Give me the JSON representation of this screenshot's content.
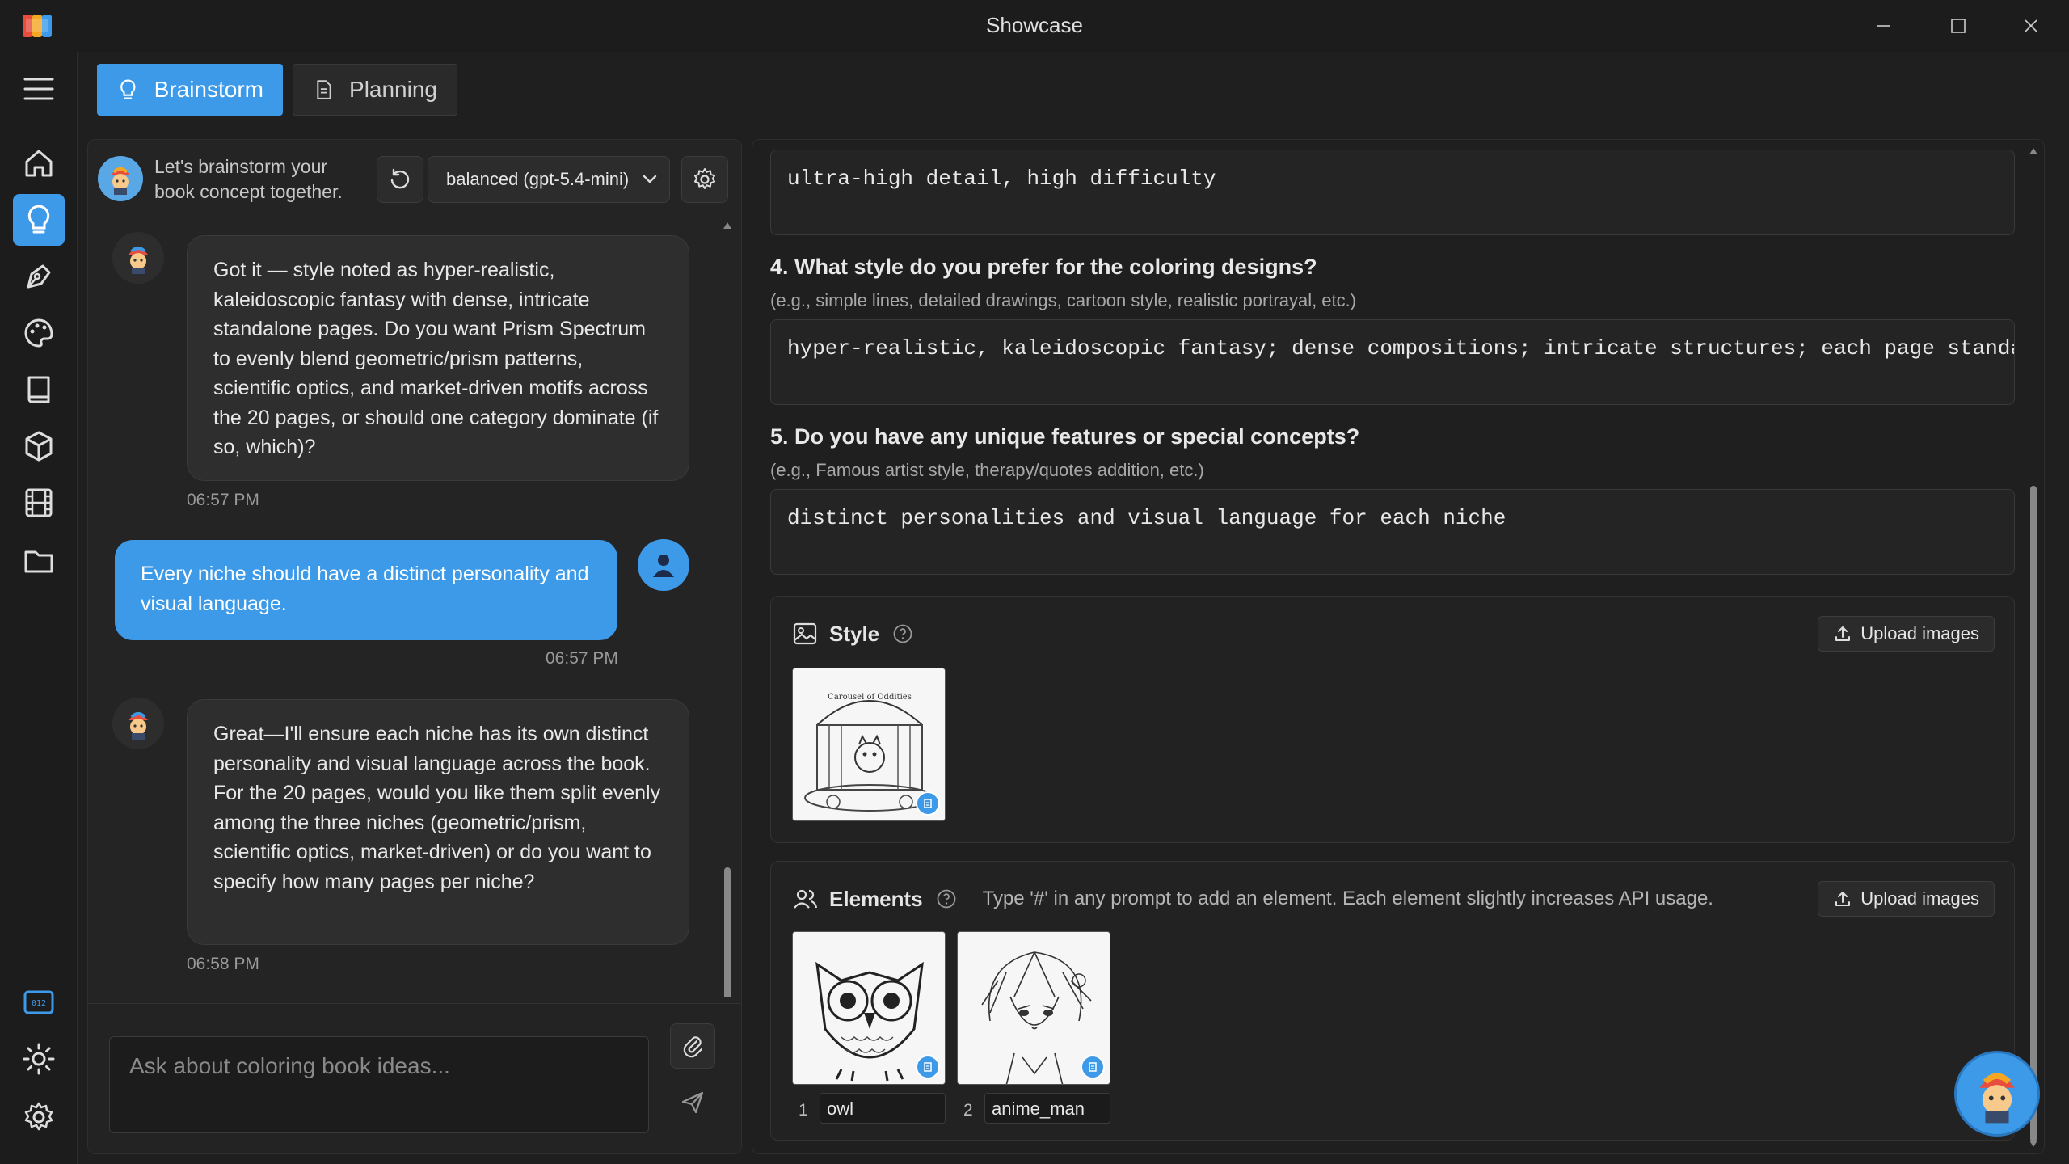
{
  "window": {
    "title": "Showcase"
  },
  "tabs": [
    {
      "label": "Brainstorm",
      "active": true
    },
    {
      "label": "Planning",
      "active": false
    }
  ],
  "chat": {
    "intro": "Let's brainstorm your book concept together.",
    "model": "balanced (gpt-5.4-mini)",
    "messages": [
      {
        "role": "bot",
        "text": "Got it — style noted as hyper-realistic, kaleidoscopic fantasy with dense, intricate standalone pages. Do you want Prism Spectrum to evenly blend geometric/prism patterns, scientific optics, and market-driven motifs across the 20 pages, or should one category dominate (if so, which)?",
        "time": "06:57 PM"
      },
      {
        "role": "user",
        "text": "Every niche should have a distinct personality and visual language.",
        "time": "06:57 PM"
      },
      {
        "role": "bot",
        "text": "Great—I'll ensure each niche has its own distinct personality and visual language across the book. For the 20 pages, would you like them split evenly among the three niches (geometric/prism, scientific optics, market-driven) or do you want to specify how many pages per niche?",
        "time": "06:58 PM"
      }
    ],
    "input_placeholder": "Ask about coloring book ideas..."
  },
  "form": {
    "q3_answer": "ultra-high detail, high difficulty",
    "q4": {
      "title": "4. What style do you prefer for the coloring designs?",
      "hint": "(e.g., simple lines, detailed drawings, cartoon style, realistic portrayal, etc.)",
      "answer": "hyper-realistic, kaleidoscopic fantasy; dense compositions; intricate structures; each page standalone"
    },
    "q5": {
      "title": "5. Do you have any unique features or special concepts?",
      "hint": "(e.g., Famous artist style, therapy/quotes addition, etc.)",
      "answer": "distinct personalities and visual language for each niche"
    },
    "style_card": {
      "title": "Style",
      "upload_label": "Upload images",
      "thumb_caption": "Carousel of Oddities"
    },
    "elements_card": {
      "title": "Elements",
      "hint": "Type '#' in any prompt to add an element. Each element slightly increases API usage.",
      "upload_label": "Upload images",
      "items": [
        {
          "num": "1",
          "name": "owl"
        },
        {
          "num": "2",
          "name": "anime_man"
        }
      ]
    }
  },
  "sidebar": {
    "icons": [
      "menu-icon",
      "home-icon",
      "lightbulb-icon",
      "pen-tool-icon",
      "palette-icon",
      "book-icon",
      "cube-icon",
      "film-icon",
      "folder-icon",
      "counter-icon",
      "sun-icon",
      "settings-icon"
    ],
    "counter_text": "012"
  },
  "colors": {
    "accent": "#3d9ae8",
    "bg": "#1f1f1f",
    "panel": "#242424"
  }
}
